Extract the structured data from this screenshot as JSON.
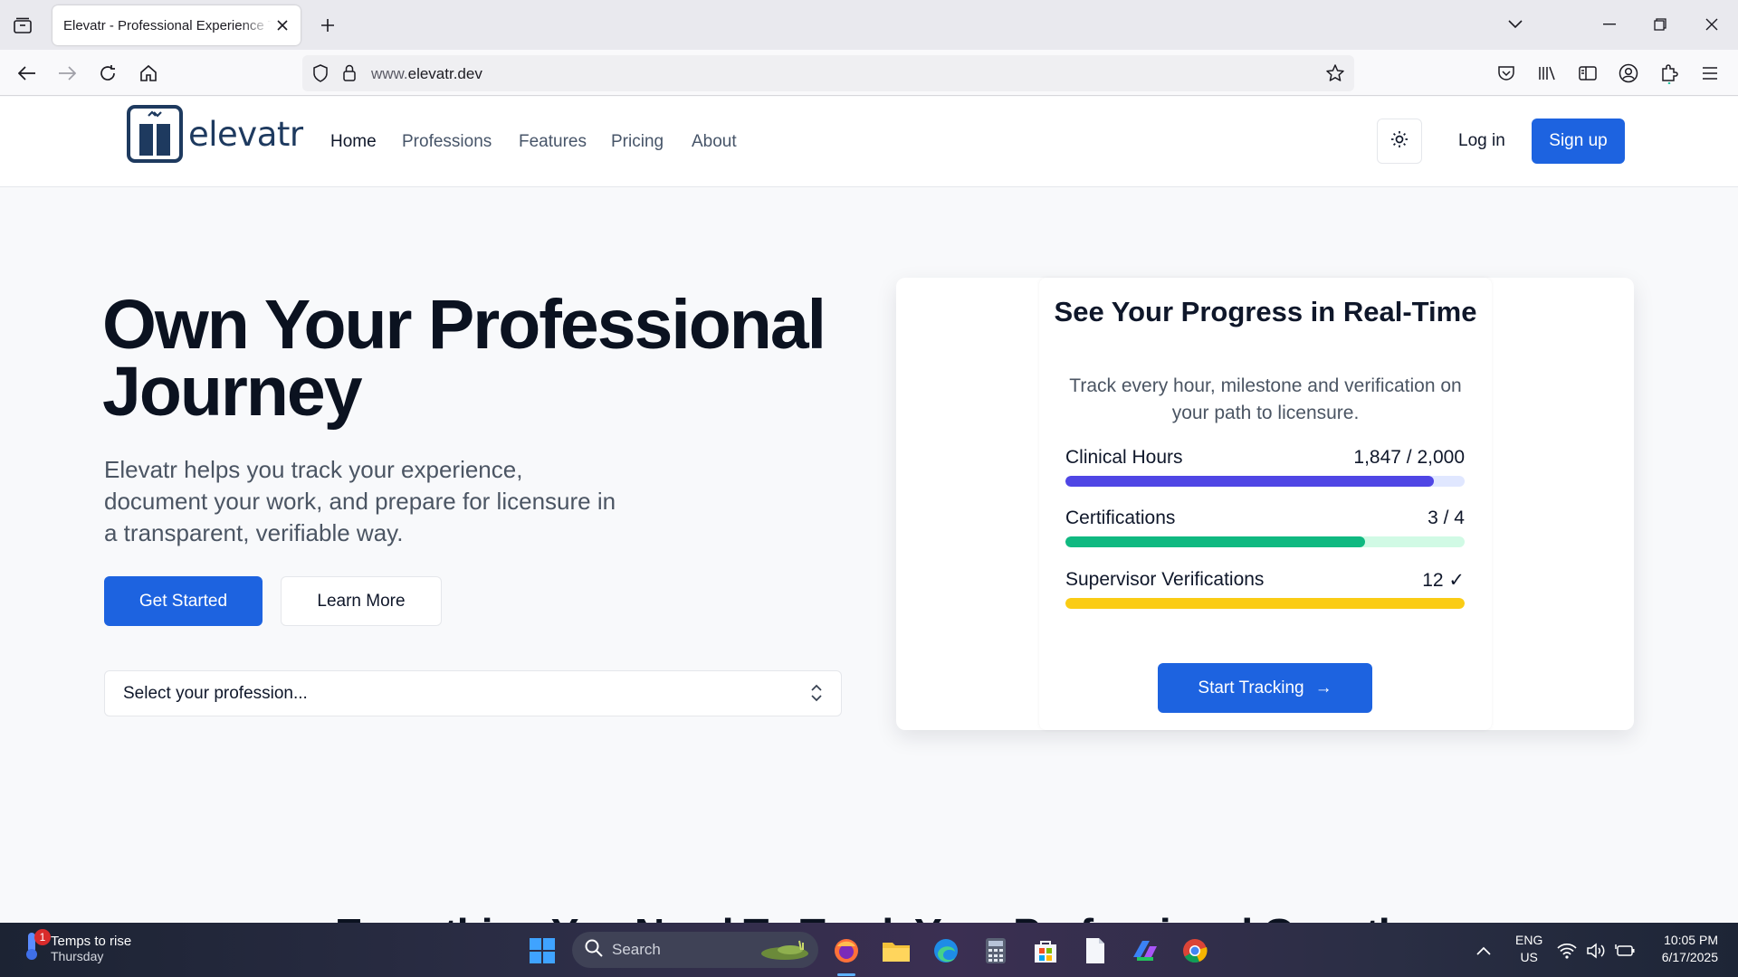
{
  "browser": {
    "tab_title": "Elevatr - Professional Experience Tracker",
    "url_prefix": "www.",
    "url_domain": "elevatr.dev"
  },
  "site": {
    "logo_text": "elevatr",
    "nav": [
      "Home",
      "Professions",
      "Features",
      "Pricing",
      "About"
    ],
    "active_nav": "Home",
    "login_label": "Log in",
    "signup_label": "Sign up"
  },
  "hero": {
    "title_line1": "Own Your Professional",
    "title_line2": "Journey",
    "subtitle": "Elevatr helps you track your experience, document your work, and prepare for licensure in a transparent, verifiable way.",
    "primary_cta": "Get Started",
    "secondary_cta": "Learn More",
    "select_placeholder": "Select your profession..."
  },
  "progress_card": {
    "title": "See Your Progress in Real-Time",
    "description": "Track every hour, milestone and verification on your path to licensure.",
    "stats": [
      {
        "label": "Clinical Hours",
        "value": "1,847 / 2,000",
        "fraction": 0.9235,
        "fill": "#4f46e5",
        "track": "#e0e7ff"
      },
      {
        "label": "Certifications",
        "value": "3 / 4",
        "fraction": 0.75,
        "fill": "#10b981",
        "track": "#d1fae5"
      },
      {
        "label": "Supervisor Verifications",
        "value": "12 ✓",
        "fraction": 1.0,
        "fill": "#facc15",
        "track": "#fef9c3"
      }
    ],
    "cta": "Start Tracking",
    "cta_arrow": "→"
  },
  "next_section_heading": "Everything You Need To Track Your Professional Growth",
  "taskbar": {
    "weather_line1": "Temps to rise",
    "weather_line2": "Thursday",
    "weather_badge": "1",
    "search_label": "Search",
    "lang_line1": "ENG",
    "lang_line2": "US",
    "time": "10:05 PM",
    "date": "6/17/2025"
  }
}
